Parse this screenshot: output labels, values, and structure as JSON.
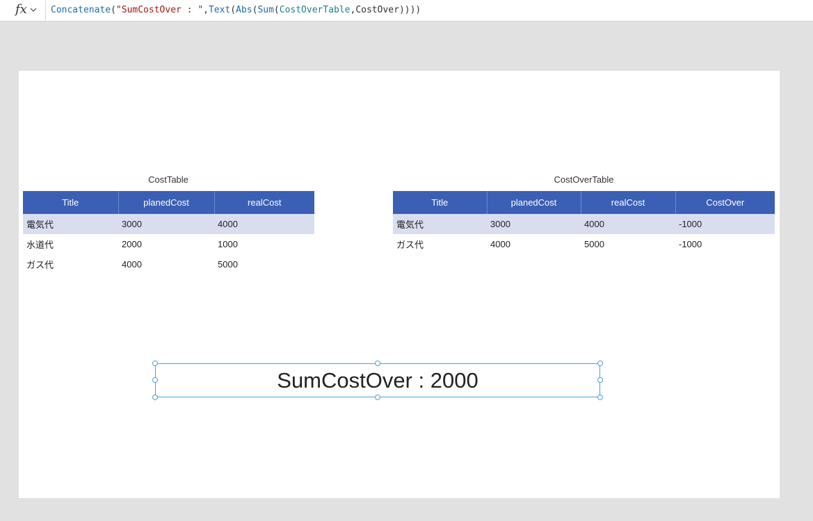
{
  "formula_bar": {
    "fx_label": "fx",
    "formula_tokens": [
      {
        "text": "Concatenate",
        "kind": "fn"
      },
      {
        "text": "(",
        "kind": "punct"
      },
      {
        "text": "\"SumCostOver : \"",
        "kind": "str"
      },
      {
        "text": ",",
        "kind": "punct"
      },
      {
        "text": "Text",
        "kind": "fn"
      },
      {
        "text": "(",
        "kind": "punct"
      },
      {
        "text": "Abs",
        "kind": "fn"
      },
      {
        "text": "(",
        "kind": "punct"
      },
      {
        "text": "Sum",
        "kind": "fn"
      },
      {
        "text": "(",
        "kind": "punct"
      },
      {
        "text": "CostOverTable",
        "kind": "id"
      },
      {
        "text": ",CostOver))))",
        "kind": "punct"
      }
    ]
  },
  "cost_table": {
    "title": "CostTable",
    "columns": [
      "Title",
      "planedCost",
      "realCost"
    ],
    "rows": [
      [
        "電気代",
        "3000",
        "4000"
      ],
      [
        "水道代",
        "2000",
        "1000"
      ],
      [
        "ガス代",
        "4000",
        "5000"
      ]
    ],
    "selected_row": 0
  },
  "cost_over_table": {
    "title": "CostOverTable",
    "columns": [
      "Title",
      "planedCost",
      "realCost",
      "CostOver"
    ],
    "rows": [
      [
        "電気代",
        "3000",
        "4000",
        "-1000"
      ],
      [
        "ガス代",
        "4000",
        "5000",
        "-1000"
      ]
    ],
    "selected_row": 0
  },
  "result_label": {
    "text": "SumCostOver : 2000"
  },
  "colors": {
    "header_bg": "#3a5fb4",
    "selected_row_bg": "#d8def0",
    "selection_border": "#4a9fe0",
    "canvas_bg": "#ffffff",
    "workspace_bg": "#e1e1e1"
  }
}
